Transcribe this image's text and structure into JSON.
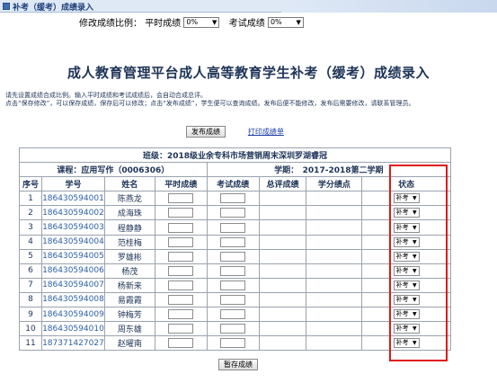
{
  "window": {
    "title": "补考（缓考）成绩录入"
  },
  "ratio": {
    "label": "修改成绩比例：",
    "regular_label": "平时成绩",
    "regular_value": "0%",
    "exam_label": "考试成绩",
    "exam_value": "0%"
  },
  "page_title": "成人教育管理平台成人高等教育学生补考（缓考）成绩录入",
  "notes": {
    "line1": "请先设置成绩合成比例。输入平时成绩和考试成绩后，会自动合成总评。",
    "line2": "点击“保存修改”，可以保存成绩，保存后可以修改；点击“发布成绩”，学生便可以查询成绩。发布后便不能修改，发布后需要修改，请联系管理员。"
  },
  "actions": {
    "publish": "发布成绩",
    "print": "打印成绩单",
    "save_temp": "暂存成绩"
  },
  "class_info": "班级：2018级业余专科市场营销周末深圳罗湖睿冠",
  "course_info": "课程：应用写作（0006306）",
  "term_info": "学期：　2017-2018第二学期",
  "columns": [
    "序号",
    "学号",
    "姓名",
    "平时成绩",
    "考试成绩",
    "总评成绩",
    "学分绩点",
    "状态"
  ],
  "students": [
    {
      "no": "1",
      "id": "186430594001",
      "name": "陈燕龙",
      "status": "补考"
    },
    {
      "no": "2",
      "id": "186430594002",
      "name": "成海珠",
      "status": "补考"
    },
    {
      "no": "3",
      "id": "186430594003",
      "name": "程静静",
      "status": "补考"
    },
    {
      "no": "4",
      "id": "186430594004",
      "name": "范桂梅",
      "status": "补考"
    },
    {
      "no": "5",
      "id": "186430594005",
      "name": "罗雄彬",
      "status": "补考"
    },
    {
      "no": "6",
      "id": "186430594006",
      "name": "杨茂",
      "status": "补考"
    },
    {
      "no": "7",
      "id": "186430594007",
      "name": "杨新来",
      "status": "补考"
    },
    {
      "no": "8",
      "id": "186430594008",
      "name": "易霞霞",
      "status": "补考"
    },
    {
      "no": "9",
      "id": "186430594009",
      "name": "钟梅芳",
      "status": "补考"
    },
    {
      "no": "10",
      "id": "186430594010",
      "name": "周东雄",
      "status": "补考"
    },
    {
      "no": "11",
      "id": "187371427027",
      "name": "赵曜南",
      "status": "补考"
    }
  ],
  "colors": {
    "highlight_box": "#e01818",
    "link": "#1a3ea8",
    "title": "#1d3357"
  }
}
